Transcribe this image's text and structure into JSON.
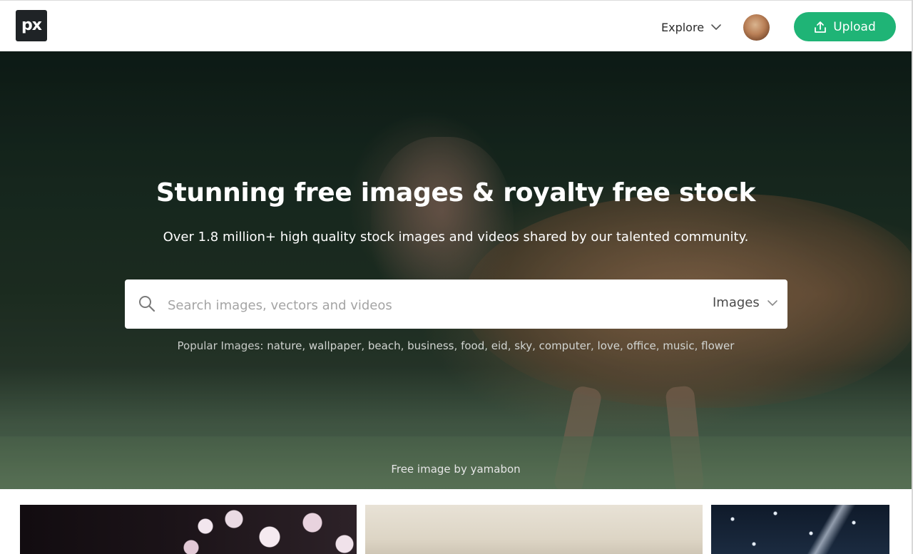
{
  "header": {
    "logo_text": "px",
    "explore_label": "Explore",
    "upload_label": "Upload"
  },
  "hero": {
    "title": "Stunning free images & royalty free stock",
    "subtitle": "Over 1.8 million+ high quality stock images and videos shared by our talented community.",
    "search": {
      "placeholder": "Search images, vectors and videos",
      "type_selected": "Images"
    },
    "popular_label": "Popular Images:",
    "popular_tags": [
      "nature",
      "wallpaper",
      "beach",
      "business",
      "food",
      "eid",
      "sky",
      "computer",
      "love",
      "office",
      "music",
      "flower"
    ],
    "credit": "Free image by yamabon"
  },
  "colors": {
    "accent": "#1fb476",
    "logo_bg": "#1f2326"
  },
  "icons": {
    "search": "search-icon",
    "upload": "upload-icon",
    "chevron": "chevron-down-icon"
  }
}
